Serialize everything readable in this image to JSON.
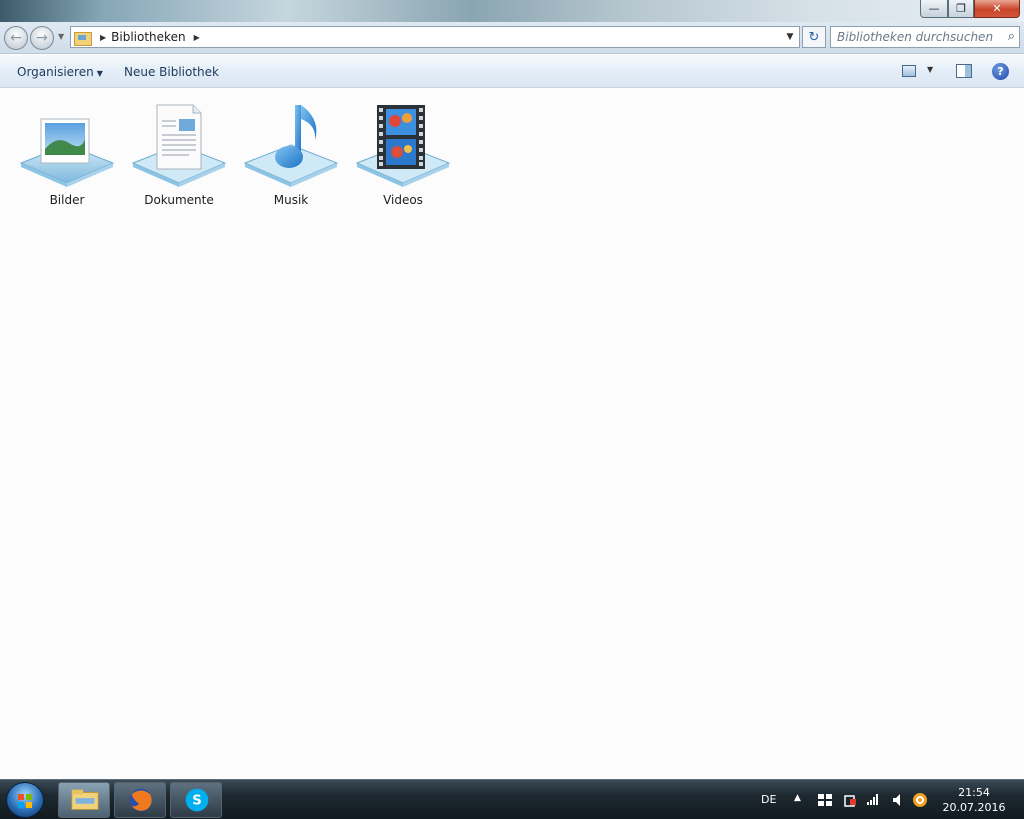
{
  "window": {
    "controls": {
      "minimize": "—",
      "maximize": "❐",
      "close": "✕"
    }
  },
  "navigation": {
    "back_icon": "←",
    "forward_icon": "→",
    "address": {
      "crumb": "Bibliotheken"
    },
    "refresh_icon": "↻",
    "search": {
      "placeholder": "Bibliotheken durchsuchen",
      "icon": "⌕"
    }
  },
  "toolbar": {
    "organize_label": "Organisieren",
    "new_library_label": "Neue Bibliothek",
    "help_label": "?"
  },
  "libraries": [
    {
      "label": "Bilder",
      "icon": "pictures-library-icon"
    },
    {
      "label": "Dokumente",
      "icon": "documents-library-icon"
    },
    {
      "label": "Musik",
      "icon": "music-library-icon"
    },
    {
      "label": "Videos",
      "icon": "videos-library-icon"
    }
  ],
  "taskbar": {
    "language": "DE",
    "time": "21:54",
    "date": "20.07.2016"
  },
  "colors": {
    "accent": "#1e395b",
    "close_red": "#c9452a",
    "shelf_blue": "#8fc6e6"
  }
}
